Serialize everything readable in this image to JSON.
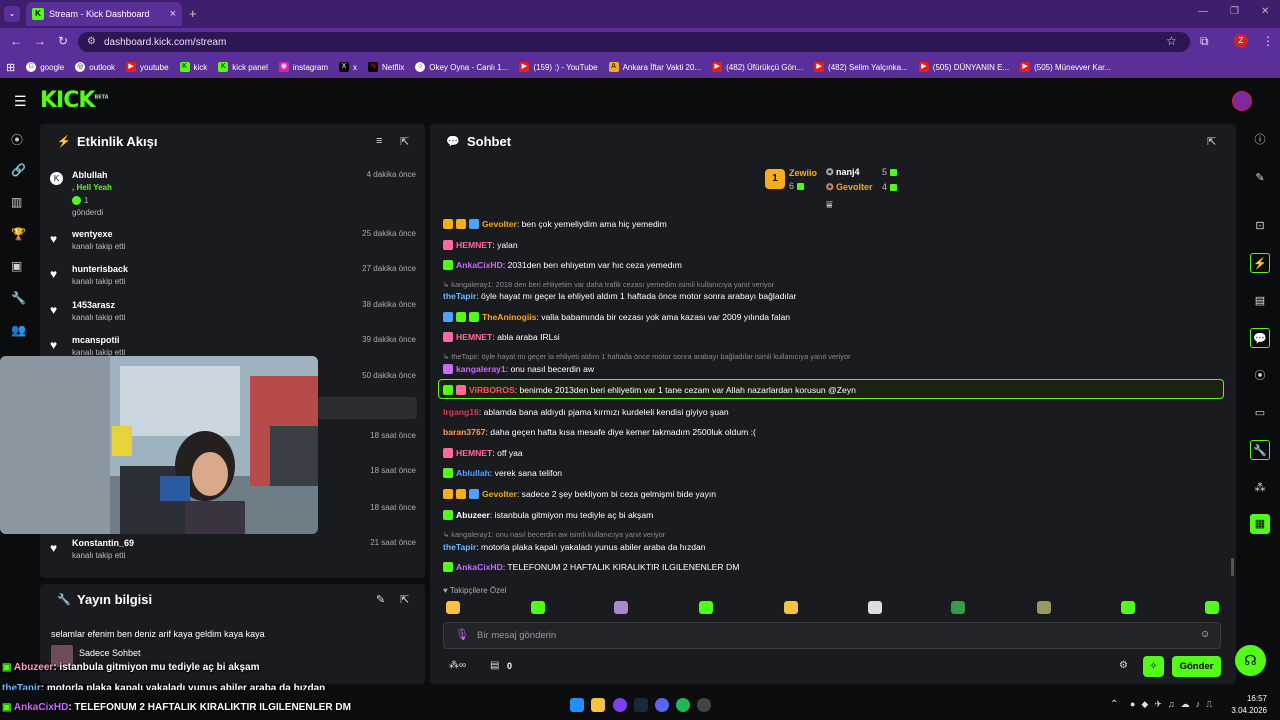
{
  "browser": {
    "tab_title": "Stream - Kick Dashboard",
    "url": "dashboard.kick.com/stream",
    "profile_letter": "Z",
    "bookmarks": [
      "google",
      "outlook",
      "youtube",
      "kick",
      "kick panel",
      "instagram",
      "x",
      "Netflix",
      "Okey Oyna - Canlı 1...",
      "(159) :) - YouTube",
      "Ankara İftar Vakti 20...",
      "(482) Üfürükçü Gön...",
      "(482) Selim Yalçınka...",
      "(505) DÜNYANIN E...",
      "(505) Münevver Kar..."
    ]
  },
  "kick": {
    "logo": "KICK",
    "logo_sup": "BETA"
  },
  "activity": {
    "title": "Etkinlik Akışı",
    "items": [
      {
        "name": "Ablullah",
        "gift_line": ", Hell Yeah",
        "gift_count": "1",
        "sub": "gönderdi",
        "time": "4 dakika önce"
      },
      {
        "name": "wentyexe",
        "sub": "kanalı takip etti",
        "time": "25 dakika önce"
      },
      {
        "name": "hunterisback",
        "sub": "kanalı takip etti",
        "time": "27 dakika önce"
      },
      {
        "name": "1453arasz",
        "sub": "kanalı takip etti",
        "time": "38 dakika önce"
      },
      {
        "name": "mcanspotii",
        "sub": "kanalı takip etti",
        "time": "39 dakika önce"
      },
      {
        "time": "50 dakika önce"
      },
      {
        "time": "18 saat önce"
      },
      {
        "time": "18 saat önce"
      },
      {
        "time": "18 saat önce"
      },
      {
        "name": "Konstantin_69",
        "sub": "kanalı takip etti",
        "time": "21 saat önce"
      }
    ]
  },
  "stream_info": {
    "title": "Yayın bilgisi",
    "stream_title": "selamlar efenim ben deniz arif kaya geldim kaya kaya",
    "category": "Sadece Sohbet"
  },
  "chat": {
    "title": "Sohbet",
    "leaderboard": [
      {
        "rank": "1",
        "name": "Zewiio",
        "count": "6"
      },
      {
        "name": "nanj4",
        "count": "5"
      },
      {
        "name": "Gevolter",
        "count": "4"
      }
    ],
    "messages": [
      {
        "user": "Gevolter",
        "text": ": ben çok yemeliydim ama hiç yemedim",
        "color": "#f5a623"
      },
      {
        "user": "HEMNET",
        "text": ": yalan",
        "color": "#ff6b9a"
      },
      {
        "user": "AnkaCixHD",
        "text": ": 2031den berı ehlıyetım var hıc ceza yemedım",
        "color": "#c76bff"
      },
      {
        "reply": "kangaleray1: 2018 den beri ehliyetim var daha trafik cezası yemedim isimli kullanıcıya yanıt veriyor"
      },
      {
        "user": "theTapir",
        "text": ": öyle hayat mı geçer la ehliyeti aldım 1 haftada önce motor sonra arabayı bağladılar",
        "color": "#6ab7ff"
      },
      {
        "user": "TheAninogiis",
        "text": ": valla babamında bir cezası yok ama kazası var 2009 yılında falan",
        "color": "#f5a623"
      },
      {
        "user": "HEMNET",
        "text": ": abla araba IRLsi",
        "color": "#ff6b9a"
      },
      {
        "reply": "theTapir: öyle hayat mı geçer la ehliyeti aldım 1 haftada önce motor sonra arabayı bağladılar isimli kullanıcıya yanıt veriyor"
      },
      {
        "user": "kangaleray1",
        "text": ": onu nasıl becerdin aw",
        "color": "#c76bff"
      },
      {
        "user": "ViRBOROS",
        "text": ": benimde 2013den beri ehliyetim var 1 tane cezam var Allah nazarlardan korusun @Zeyn",
        "color": "#ff4f6e",
        "highlight": true
      },
      {
        "user": "lrgang16",
        "text": ": ablamda bana aldıydı pjama kırmızı kurdeleli kendisi giyiyo şuan",
        "color": "#e0384f"
      },
      {
        "user": "baran3767",
        "text": ": daha geçen hafta kısa mesafe diye kemer takmadım 2500luk oldum :(",
        "color": "#ff9a5a"
      },
      {
        "user": "HEMNET",
        "text": ": off yaa",
        "color": "#ff6b9a"
      },
      {
        "user": "Ablullah",
        "text": ": verek sana telifon",
        "color": "#4fa3ff"
      },
      {
        "user": "Gevolter",
        "text": ": sadece 2 şey bekliyom bi ceza gelmişmi bide yayın",
        "color": "#f5a623"
      },
      {
        "user": "Abuzeer",
        "text": ": istanbula gitmiyon mu tediyle aç bi akşam",
        "color": "#ffffff"
      },
      {
        "reply": "kangaleray1: onu nasıl becerdin aw isimli kullanıcıya yanıt veriyor"
      },
      {
        "user": "theTapir",
        "text": ": motorla plaka kapalı yakaladı yunus abiler araba da hızdan",
        "color": "#6ab7ff"
      },
      {
        "user": "AnkaCixHD",
        "text": ": TELEFONUM 2 HAFTALIK KIRALIKTIR ILGILENENLER DM",
        "color": "#c76bff"
      }
    ],
    "followers_only": "Takipçilere Özel",
    "input_placeholder": "Bir mesaj gönderin",
    "points": "0",
    "send_label": "Gönder"
  },
  "overlay": [
    {
      "user": "Abuzeer",
      "text": ": istanbula gitmiyon mu tediyle aç bi akşam"
    },
    {
      "user": "theTapir",
      "text": ": motorla plaka kapalı yakaladı yunus abiler araba da hızdan"
    },
    {
      "user": "AnkaCixHD",
      "text": ": TELEFONUM 2 HAFTALIK KIRALIKTIR ILGILENENLER DM"
    }
  ],
  "taskbar": {
    "time": "16:57",
    "date": "3.04.2026"
  },
  "colors": {
    "kick_green": "#53fc18",
    "chrome_purple": "#5b2f9a",
    "panel_bg": "#191b1f"
  }
}
